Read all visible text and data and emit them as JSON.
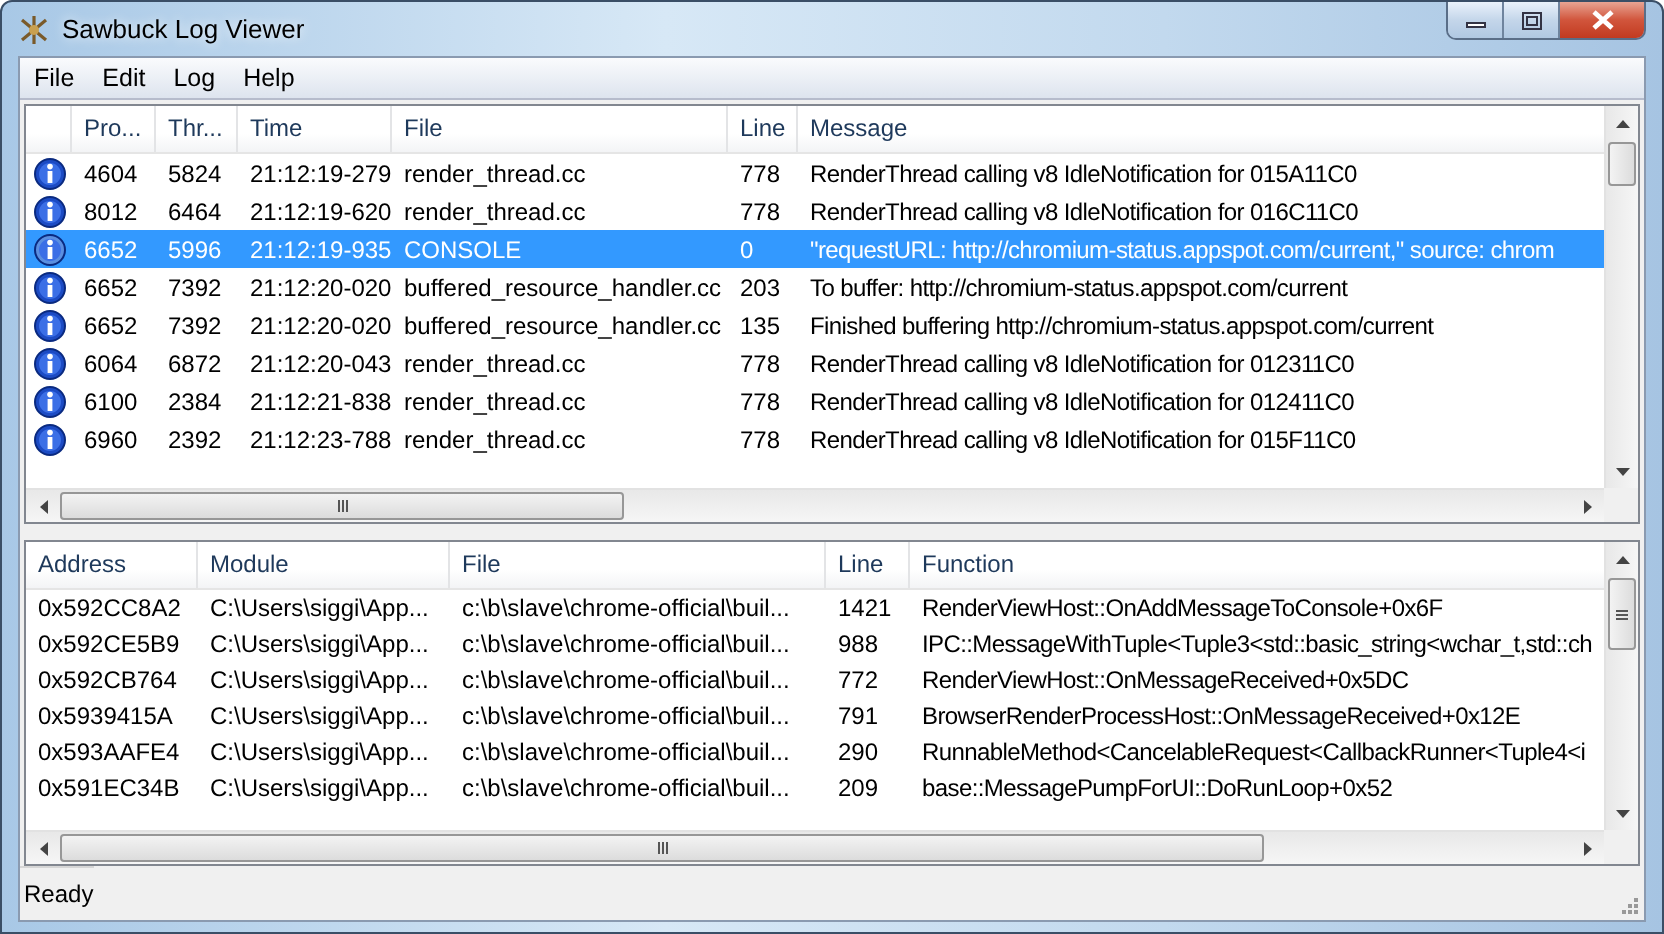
{
  "window": {
    "title": "Sawbuck Log Viewer"
  },
  "menu": [
    "File",
    "Edit",
    "Log",
    "Help"
  ],
  "log_table": {
    "columns": [
      "Pro...",
      "Thr...",
      "Time",
      "File",
      "Line",
      "Message"
    ],
    "rows": [
      {
        "kind": "info",
        "selected": false,
        "cells": [
          "4604",
          "5824",
          "21:12:19-279",
          "render_thread.cc",
          "778",
          "RenderThread calling v8 IdleNotification for 015A11C0"
        ]
      },
      {
        "kind": "info",
        "selected": false,
        "cells": [
          "8012",
          "6464",
          "21:12:19-620",
          "render_thread.cc",
          "778",
          "RenderThread calling v8 IdleNotification for 016C11C0"
        ]
      },
      {
        "kind": "info",
        "selected": true,
        "cells": [
          "6652",
          "5996",
          "21:12:19-935",
          "CONSOLE",
          "0",
          "\"requestURL: http://chromium-status.appspot.com/current,\" source: chrom"
        ]
      },
      {
        "kind": "info",
        "selected": false,
        "cells": [
          "6652",
          "7392",
          "21:12:20-020",
          "buffered_resource_handler.cc",
          "203",
          "To buffer: http://chromium-status.appspot.com/current"
        ]
      },
      {
        "kind": "info",
        "selected": false,
        "cells": [
          "6652",
          "7392",
          "21:12:20-020",
          "buffered_resource_handler.cc",
          "135",
          "Finished buffering http://chromium-status.appspot.com/current"
        ]
      },
      {
        "kind": "info",
        "selected": false,
        "cells": [
          "6064",
          "6872",
          "21:12:20-043",
          "render_thread.cc",
          "778",
          "RenderThread calling v8 IdleNotification for 012311C0"
        ]
      },
      {
        "kind": "info",
        "selected": false,
        "cells": [
          "6100",
          "2384",
          "21:12:21-838",
          "render_thread.cc",
          "778",
          "RenderThread calling v8 IdleNotification for 012411C0"
        ]
      },
      {
        "kind": "info",
        "selected": false,
        "cells": [
          "6960",
          "2392",
          "21:12:23-788",
          "render_thread.cc",
          "778",
          "RenderThread calling v8 IdleNotification for 015F11C0"
        ]
      }
    ]
  },
  "stack_table": {
    "columns": [
      "Address",
      "Module",
      "File",
      "Line",
      "Function"
    ],
    "rows": [
      {
        "selected": false,
        "cells": [
          "0x592CC8A2",
          "C:\\Users\\siggi\\App...",
          "c:\\b\\slave\\chrome-official\\buil...",
          "1421",
          "RenderViewHost::OnAddMessageToConsole+0x6F"
        ]
      },
      {
        "selected": false,
        "cells": [
          "0x592CE5B9",
          "C:\\Users\\siggi\\App...",
          "c:\\b\\slave\\chrome-official\\buil...",
          "988",
          "IPC::MessageWithTuple<Tuple3<std::basic_string<wchar_t,std::ch"
        ]
      },
      {
        "selected": false,
        "cells": [
          "0x592CB764",
          "C:\\Users\\siggi\\App...",
          "c:\\b\\slave\\chrome-official\\buil...",
          "772",
          "RenderViewHost::OnMessageReceived+0x5DC"
        ]
      },
      {
        "selected": false,
        "cells": [
          "0x5939415A",
          "C:\\Users\\siggi\\App...",
          "c:\\b\\slave\\chrome-official\\buil...",
          "791",
          "BrowserRenderProcessHost::OnMessageReceived+0x12E"
        ]
      },
      {
        "selected": false,
        "cells": [
          "0x593AAFE4",
          "C:\\Users\\siggi\\App...",
          "c:\\b\\slave\\chrome-official\\buil...",
          "290",
          "RunnableMethod<CancelableRequest<CallbackRunner<Tuple4<i"
        ]
      },
      {
        "selected": false,
        "cells": [
          "0x591EC34B",
          "C:\\Users\\siggi\\App...",
          "c:\\b\\slave\\chrome-official\\buil...",
          "209",
          "base::MessagePumpForUI::DoRunLoop+0x52"
        ]
      }
    ]
  },
  "status_bar": "Ready"
}
